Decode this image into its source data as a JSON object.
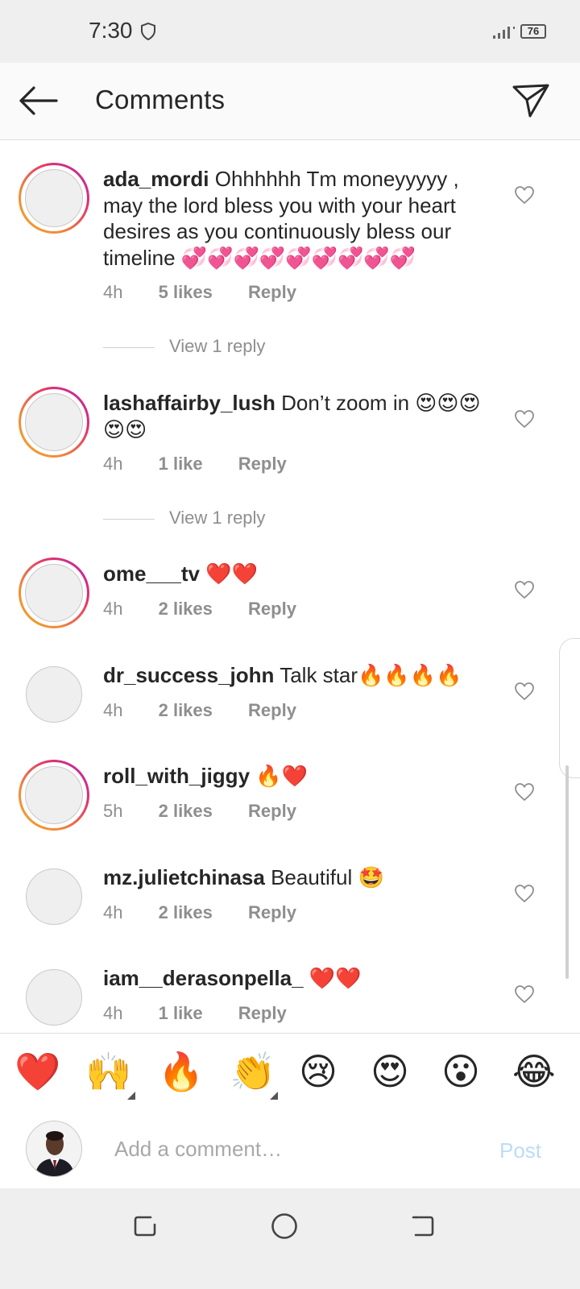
{
  "status": {
    "time": "7:30",
    "battery": "76"
  },
  "header": {
    "title": "Comments"
  },
  "comments": [
    {
      "username": "ada_mordi",
      "text": "Ohhhhhh Tm moneyyyyy , may the lord bless you with your heart desires as you continuously bless our timeline 💞💞💞💞💞💞💞💞💞",
      "time": "4h",
      "likes": "5 likes",
      "reply": "Reply"
    },
    {
      "username": "lashaffairby_lush",
      "text": "Don’t zoom in 😍😍😍😍😍",
      "time": "4h",
      "likes": "1 like",
      "reply": "Reply"
    },
    {
      "username": "ome___tv",
      "text": "❤️❤️",
      "time": "4h",
      "likes": "2 likes",
      "reply": "Reply"
    },
    {
      "username": "dr_success_john",
      "text": "Talk star🔥🔥🔥🔥",
      "time": "4h",
      "likes": "2 likes",
      "reply": "Reply"
    },
    {
      "username": "roll_with_jiggy",
      "text": "🔥❤️",
      "time": "5h",
      "likes": "2 likes",
      "reply": "Reply"
    },
    {
      "username": "mz.julietchinasa",
      "text": "Beautiful 🤩",
      "time": "4h",
      "likes": "2 likes",
      "reply": "Reply"
    },
    {
      "username": "iam__derasonpella_",
      "text": "❤️❤️",
      "time": "4h",
      "likes": "1 like",
      "reply": "Reply"
    }
  ],
  "view_replies": [
    "View 1 reply",
    "View 1 reply"
  ],
  "emoji_bar": [
    "❤️",
    "🙌",
    "🔥",
    "👏",
    "😢",
    "😍",
    "😮",
    "😂"
  ],
  "composer": {
    "placeholder": "Add a comment…",
    "post_label": "Post"
  }
}
